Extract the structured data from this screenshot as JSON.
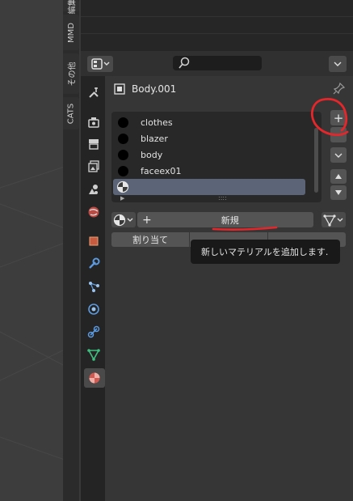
{
  "addon_tabs": [
    "編集",
    "MMD",
    "その他",
    "CATS"
  ],
  "object_name": "Body.001",
  "material_slots": [
    "clothes",
    "blazer",
    "body",
    "faceex01",
    ""
  ],
  "list_resize_handle": "::::",
  "add_slot_symbol": "+",
  "remove_slot_symbol": "−",
  "new_material_plus": "+",
  "new_material_label": "新規",
  "assign_label": "割り当て",
  "tooltip": "新しいマテリアルを追加します.",
  "property_tabs": [
    "tool-icon",
    "render-icon",
    "output-icon",
    "view-layer-icon",
    "scene-icon",
    "world-icon",
    "object-icon",
    "modifier-icon",
    "particles-icon",
    "physics-icon",
    "constraints-icon",
    "data-icon",
    "material-icon"
  ],
  "colors": {
    "annotation_red": "#e5262b",
    "selected_row": "#5b6577",
    "tooltip_bg": "#191919"
  }
}
